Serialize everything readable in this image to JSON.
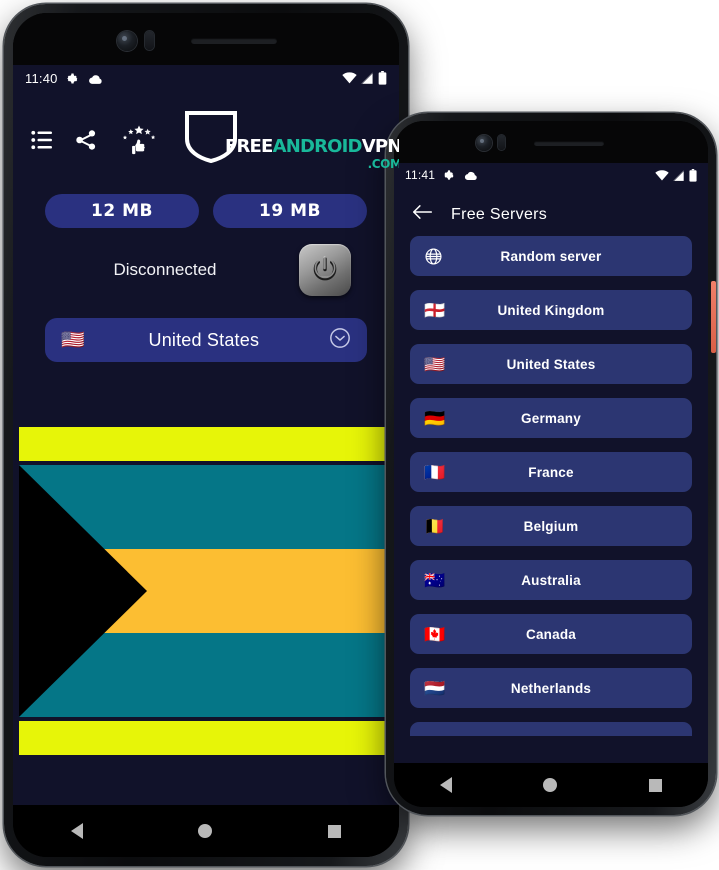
{
  "phone1": {
    "status_bar": {
      "time": "11:40",
      "icons": [
        "gear-icon",
        "cloud-icon",
        "wifi-icon",
        "signal-icon",
        "battery-icon"
      ]
    },
    "toolbar": {
      "menu_label": "list-icon",
      "share_label": "share-icon",
      "rate_label": "rate-us-icon"
    },
    "brand": {
      "free": "FREE",
      "android": "ANDROID",
      "vpn": "VPN",
      "dotcom": ".COM",
      "teal": "#19b89a",
      "white": "#ffffff"
    },
    "stats": {
      "download": "12 MB",
      "upload": "19 MB"
    },
    "connection": {
      "status": "Disconnected",
      "power_button": "power-icon"
    },
    "country": {
      "flag": "🇺🇸",
      "name": "United States",
      "chevron": "chevron-down-icon"
    },
    "flag_display": {
      "name": "Bahamas flag",
      "band_color": "#e7f508",
      "teal_color": "#057687",
      "gold_color": "#fcbe32",
      "triangle_color": "#000000"
    },
    "nav": [
      "back-button",
      "home-button",
      "recents-button"
    ]
  },
  "phone2": {
    "status_bar": {
      "time": "11:41"
    },
    "appbar": {
      "back": "back-arrow-icon",
      "title": "Free Servers"
    },
    "servers": [
      {
        "flag": "globe",
        "name": "Random server"
      },
      {
        "flag": "🏴󠁧󠁢󠁥󠁮󠁧󠁿",
        "name": "United Kingdom"
      },
      {
        "flag": "🇺🇸",
        "name": "United States"
      },
      {
        "flag": "🇩🇪",
        "name": "Germany"
      },
      {
        "flag": "🇫🇷",
        "name": "France"
      },
      {
        "flag": "🇧🇪",
        "name": "Belgium"
      },
      {
        "flag": "🇦🇺",
        "name": "Australia"
      },
      {
        "flag": "🇨🇦",
        "name": "Canada"
      },
      {
        "flag": "🇳🇱",
        "name": "Netherlands"
      }
    ],
    "nav": [
      "back-button",
      "home-button",
      "recents-button"
    ]
  },
  "theme": {
    "screen_bg": "#11122a",
    "pill_bg": "#2a3180",
    "row_bg": "#2c3672",
    "accent_teal": "#19b89a"
  }
}
